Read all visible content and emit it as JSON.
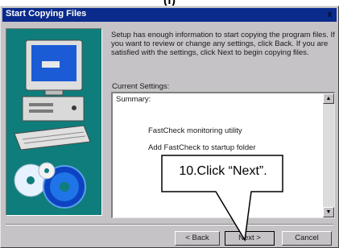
{
  "step_caption": "(f)",
  "dialog": {
    "title": "Start Copying Files",
    "close_glyph": "x",
    "intro": "Setup has enough information to start copying the program files. If you want to review or change any settings, click Back. If you are satisfied with the settings, click Next to begin copying files.",
    "current_settings_label": "Current Settings:",
    "summary_label": "Summary:",
    "summary_items": [
      "FastCheck monitoring utility",
      "Add FastCheck to startup folder"
    ],
    "buttons": {
      "back": "< Back",
      "next": "Next >",
      "cancel": "Cancel"
    }
  },
  "callout": {
    "text": "10.Click “Next”."
  },
  "icons": {
    "illustration": "computer-and-discs-illustration",
    "scroll_up": "scroll-up-arrow-icon",
    "scroll_down": "scroll-down-arrow-icon"
  },
  "colors": {
    "titlebar": "#0a2a8c",
    "dialog_face": "#c6c3c6",
    "illustration_bg": "#0f7d7b"
  }
}
